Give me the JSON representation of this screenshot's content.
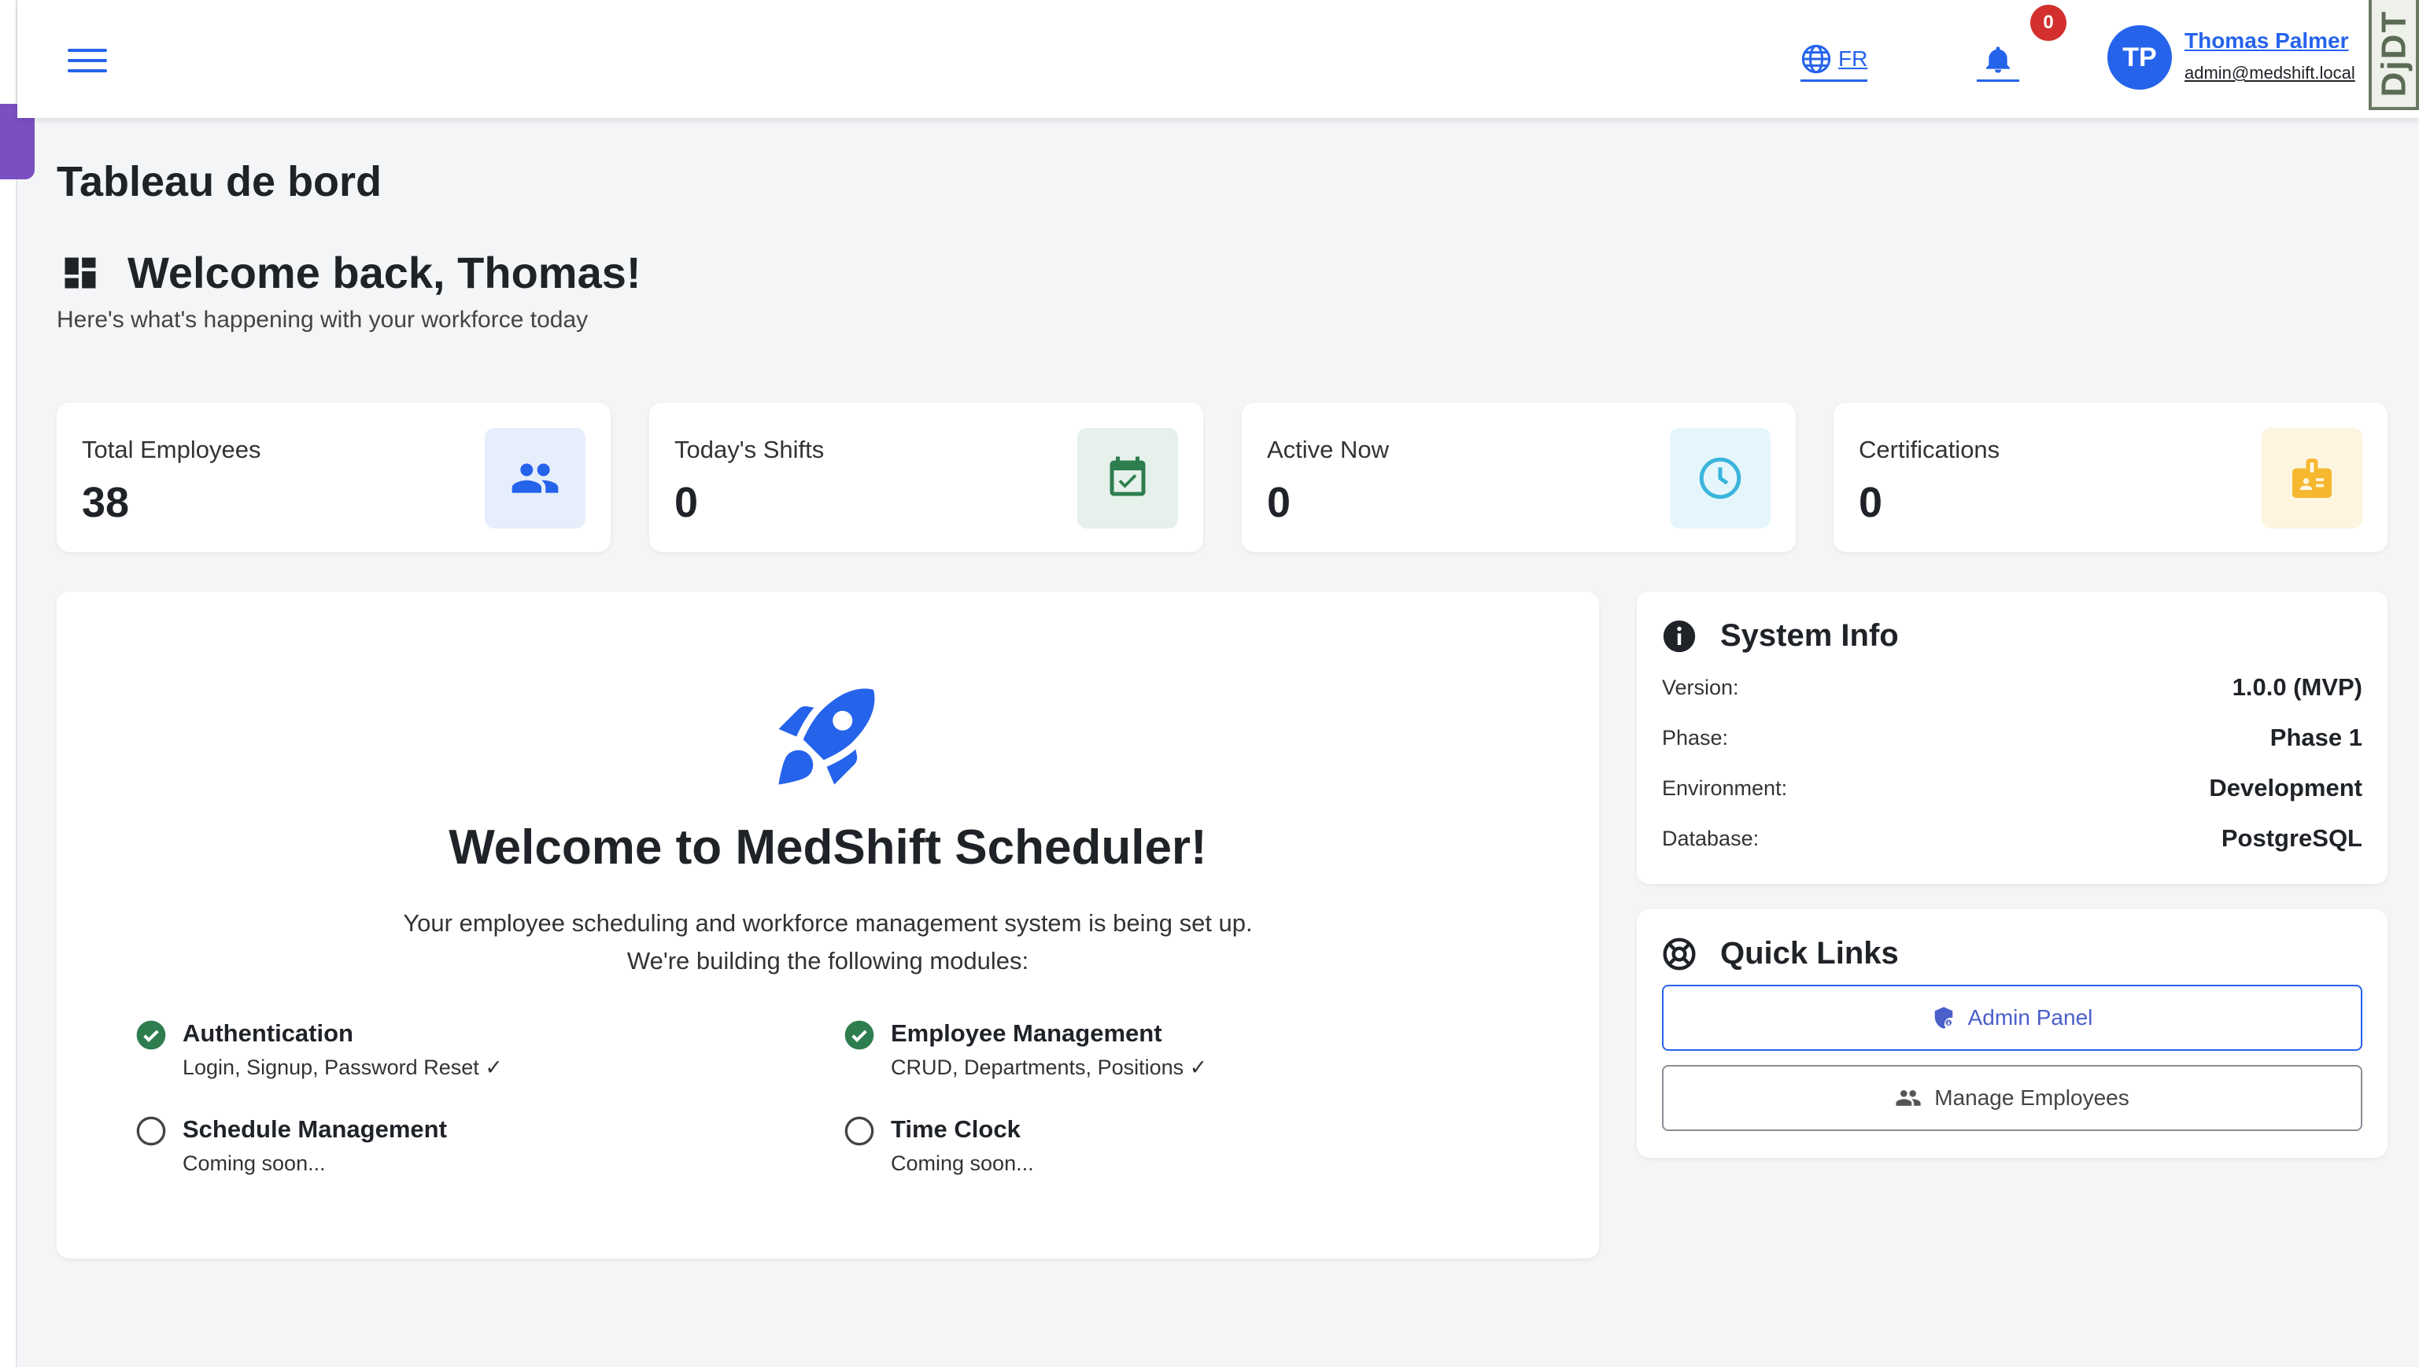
{
  "header": {
    "language": "FR",
    "notifications_count": "0",
    "user": {
      "initials": "TP",
      "name": "Thomas Palmer",
      "email": "admin@medshift.local"
    },
    "debug_toolbar_label": "DjDT"
  },
  "page": {
    "title": "Tableau de bord",
    "welcome_title": "Welcome back, Thomas!",
    "welcome_subtitle": "Here's what's happening with your workforce today"
  },
  "stats": [
    {
      "label": "Total Employees",
      "value": "38",
      "icon": "people-icon",
      "icon_bg": "#e6eefc",
      "icon_color": "#2563eb"
    },
    {
      "label": "Today's Shifts",
      "value": "0",
      "icon": "calendar-check-icon",
      "icon_bg": "#e5f1ea",
      "icon_color": "#2e7d4f"
    },
    {
      "label": "Active Now",
      "value": "0",
      "icon": "clock-icon",
      "icon_bg": "#e4f6fb",
      "icon_color": "#3ab4dc"
    },
    {
      "label": "Certifications",
      "value": "0",
      "icon": "badge-icon",
      "icon_bg": "#fdf5e0",
      "icon_color": "#f5b82e"
    }
  ],
  "main_card": {
    "title": "Welcome to MedShift Scheduler!",
    "description_line1": "Your employee scheduling and workforce management system is being set up.",
    "description_line2": "We're building the following modules:",
    "modules": [
      {
        "name": "Authentication",
        "desc": "Login, Signup, Password Reset ✓",
        "status": "done"
      },
      {
        "name": "Employee Management",
        "desc": "CRUD, Departments, Positions ✓",
        "status": "done"
      },
      {
        "name": "Schedule Management",
        "desc": "Coming soon...",
        "status": "pending"
      },
      {
        "name": "Time Clock",
        "desc": "Coming soon...",
        "status": "pending"
      }
    ]
  },
  "system_info": {
    "title": "System Info",
    "rows": [
      {
        "key": "Version:",
        "value": "1.0.0 (MVP)"
      },
      {
        "key": "Phase:",
        "value": "Phase 1"
      },
      {
        "key": "Environment:",
        "value": "Development"
      },
      {
        "key": "Database:",
        "value": "PostgreSQL"
      }
    ]
  },
  "quick_links": {
    "title": "Quick Links",
    "admin_panel": "Admin Panel",
    "manage_employees": "Manage Employees"
  },
  "colors": {
    "primary": "#2563eb",
    "success": "#2e7d4f",
    "badge_red": "#d32f2f",
    "side_tab": "#7a4fc0"
  }
}
